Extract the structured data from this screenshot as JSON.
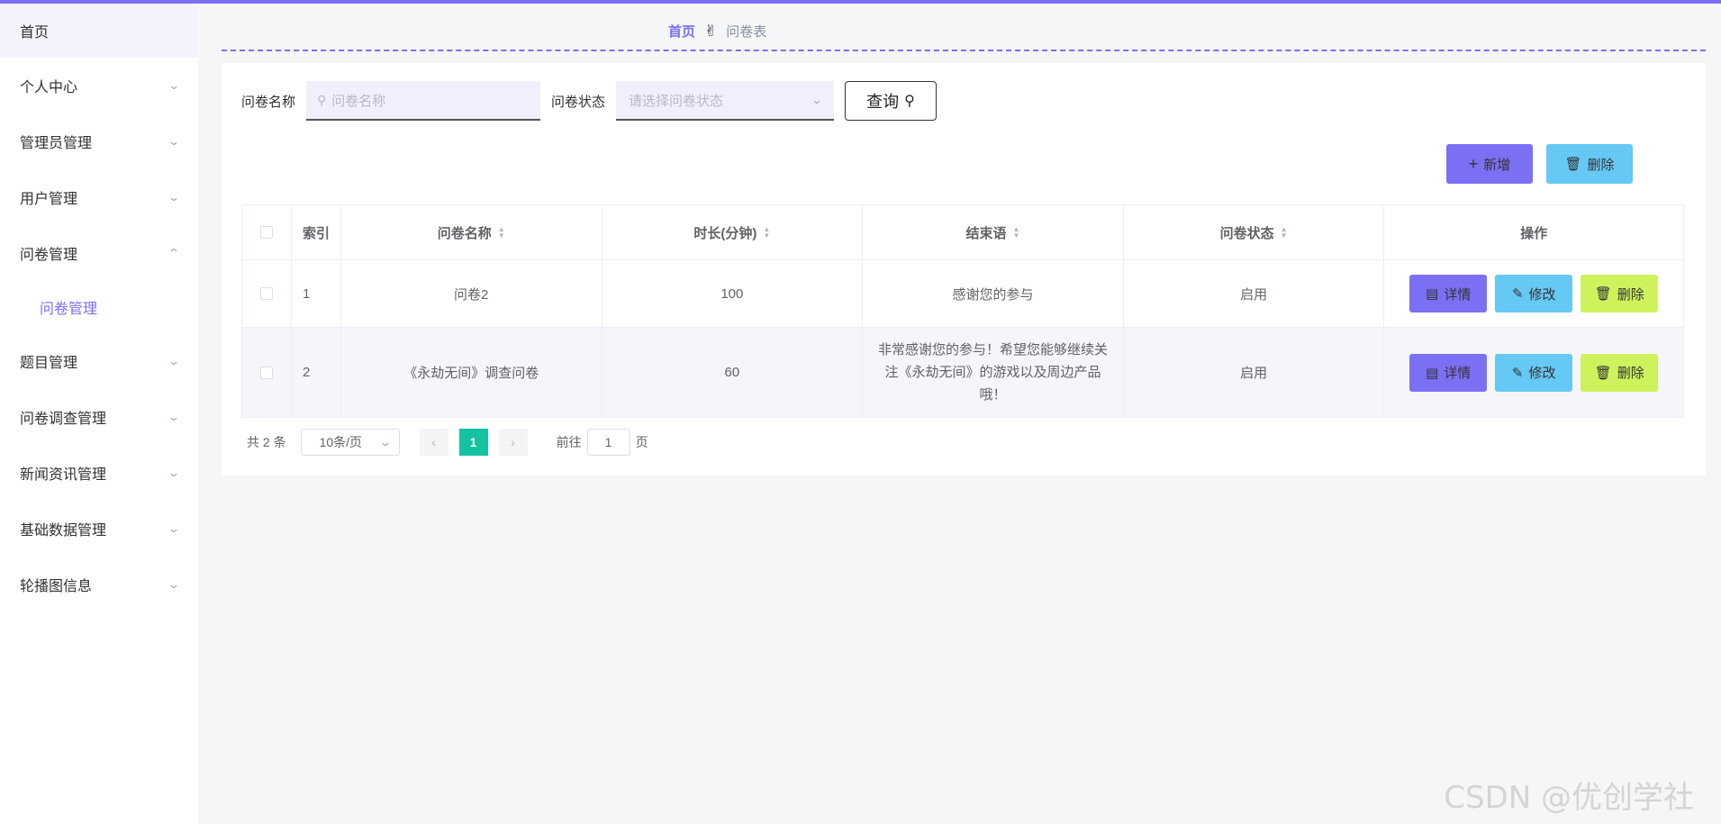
{
  "sidebar": {
    "home": "首页",
    "items": [
      {
        "label": "个人中心"
      },
      {
        "label": "管理员管理"
      },
      {
        "label": "用户管理"
      },
      {
        "label": "问卷管理",
        "expanded": true,
        "sub": [
          "问卷管理"
        ]
      },
      {
        "label": "题目管理"
      },
      {
        "label": "问卷调查管理"
      },
      {
        "label": "新闻资讯管理"
      },
      {
        "label": "基础数据管理"
      },
      {
        "label": "轮播图信息"
      }
    ]
  },
  "breadcrumb": {
    "home": "首页",
    "current": "问卷表"
  },
  "search": {
    "name_label": "问卷名称",
    "name_placeholder": "问卷名称",
    "status_label": "问卷状态",
    "status_placeholder": "请选择问卷状态",
    "query_label": "查询"
  },
  "actions": {
    "add": "新增",
    "delete": "删除"
  },
  "table": {
    "headers": [
      "索引",
      "问卷名称",
      "时长(分钟)",
      "结束语",
      "问卷状态",
      "操作"
    ],
    "rows": [
      {
        "index": "1",
        "name": "问卷2",
        "duration": "100",
        "ending": "感谢您的参与",
        "status": "启用"
      },
      {
        "index": "2",
        "name": "《永劫无间》调查问卷",
        "duration": "60",
        "ending": "非常感谢您的参与！希望您能够继续关注《永劫无间》的游戏以及周边产品哦！",
        "status": "启用"
      }
    ],
    "row_actions": {
      "detail": "详情",
      "edit": "修改",
      "delete": "删除"
    }
  },
  "pagination": {
    "total": "共 2 条",
    "page_size": "10条/页",
    "current_page": "1",
    "goto_prefix": "前往",
    "goto_value": "1",
    "goto_suffix": "页"
  },
  "watermark": "CSDN @优创学社",
  "colors": {
    "primary": "#7b6ff3",
    "info": "#66c8f5",
    "lime": "#cdf25c",
    "page_active": "#13c2a0"
  }
}
